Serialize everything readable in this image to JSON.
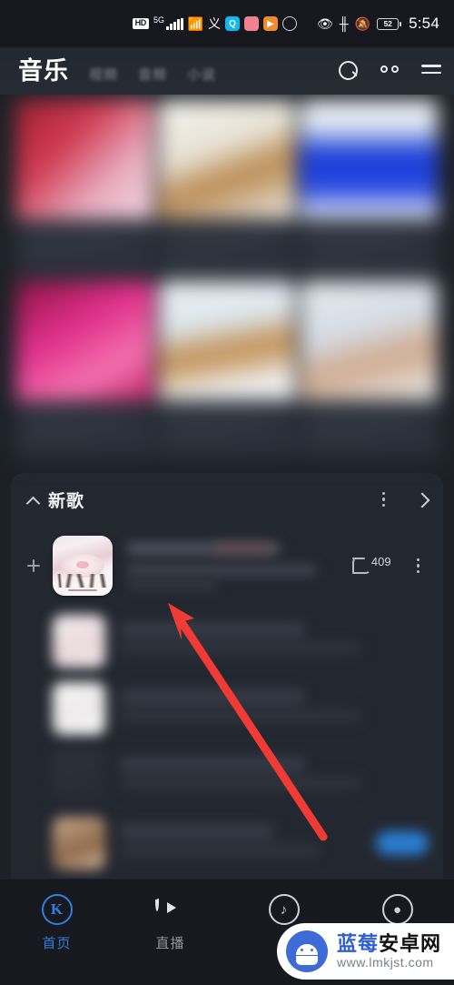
{
  "status_bar": {
    "hd_label": "HD",
    "network_label": "5G",
    "signal_icon": "signal-bars-icon",
    "wifi_icon": "wifi-icon",
    "vpn_icon": "vpn-icon",
    "app_icons": [
      "qq-icon",
      "app-pink-icon",
      "app-orange-icon",
      "shield-icon"
    ],
    "eye_icon": "eye-comfort-icon",
    "bluetooth_icon": "bluetooth-icon",
    "mute_icon": "bell-muted-icon",
    "battery_level": "52",
    "time": "5:54"
  },
  "top_nav": {
    "active_tab": "音乐",
    "tabs": [
      "视频",
      "音频",
      "小说"
    ],
    "search_icon": "search-icon",
    "discover_icon": "binocular-icon",
    "menu_icon": "hamburger-menu-icon"
  },
  "banner_grid": {
    "cells": [
      {
        "name": "banner-cell-1"
      },
      {
        "name": "banner-cell-2"
      },
      {
        "name": "banner-cell-3"
      },
      {
        "name": "banner-cell-4"
      },
      {
        "name": "banner-cell-5"
      },
      {
        "name": "banner-cell-6"
      }
    ]
  },
  "new_songs_section": {
    "collapse_icon": "chevron-up-icon",
    "title": "新歌",
    "more_icon": "kebab-menu-icon",
    "arrow_icon": "chevron-right-icon",
    "song": {
      "add_icon": "plus-icon",
      "album_art": "album-cover-thumbnail",
      "comment_icon": "comment-bubble-icon",
      "comment_count": "409",
      "row_menu_icon": "kebab-menu-icon"
    },
    "other_rows": [
      {
        "name": "song-row-blurred-1"
      },
      {
        "name": "song-row-blurred-2"
      },
      {
        "name": "song-row-blurred-3"
      },
      {
        "name": "song-row-blurred-4"
      }
    ]
  },
  "annotation": {
    "arrow_color": "#ef3b33",
    "arrow_name": "red-pointer-arrow"
  },
  "bottom_nav": {
    "items": [
      {
        "label": "首页",
        "icon": "kugou-k-icon",
        "active": true
      },
      {
        "label": "直播",
        "icon": "live-play-icon",
        "active": false
      },
      {
        "label": "",
        "icon": "music-note-icon",
        "active": false
      },
      {
        "label": "",
        "icon": "profile-icon",
        "active": false
      }
    ]
  },
  "watermark": {
    "logo_icon": "android-robot-icon",
    "site_name_part1": "蓝莓",
    "site_name_part2": "安卓网",
    "url": "www.lmkjst.com"
  }
}
